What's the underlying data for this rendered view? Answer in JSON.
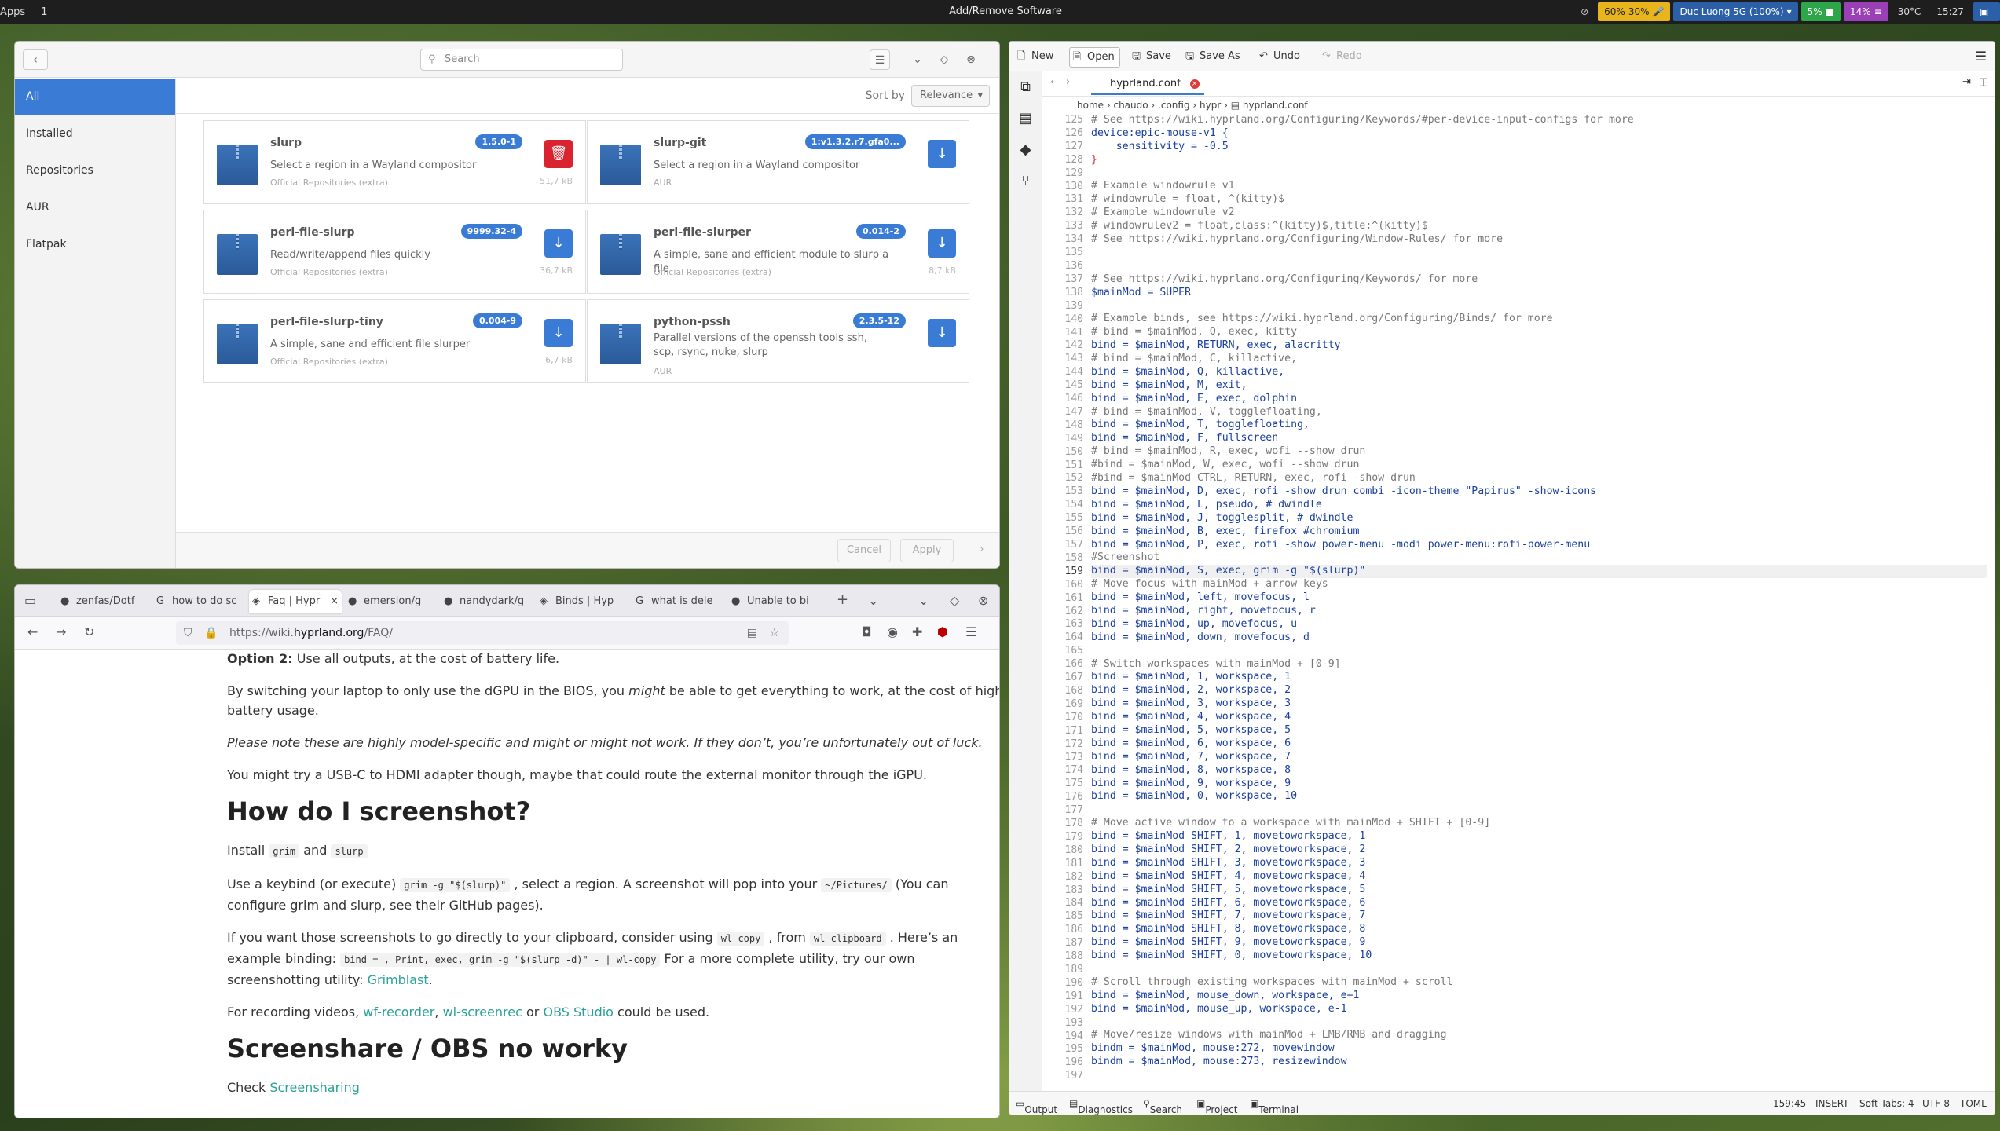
{
  "topbar": {
    "apps": "Apps",
    "workspace": "1",
    "title": "Add/Remove Software",
    "battery": "60%",
    "battery2": "30%",
    "wifi": "Duc Luong 5G (100%)",
    "cpu": "5%",
    "mem": "14%",
    "temp": "30°C",
    "clock": "15:27"
  },
  "software": {
    "search_placeholder": "Search",
    "sidebar": [
      "All",
      "Installed",
      "Repositories",
      "AUR",
      "Flatpak"
    ],
    "sort_label": "Sort by",
    "sort_value": "Relevance",
    "packages": [
      {
        "name": "slurp",
        "version": "1.5.0-1",
        "desc": "Select a region in a Wayland compositor",
        "repo": "Official Repositories (extra)",
        "size": "51,7 kB",
        "action": "delete"
      },
      {
        "name": "slurp-git",
        "version": "1:v1.3.2.r7.gfa0...",
        "desc": "Select a region in a Wayland compositor",
        "repo": "AUR",
        "size": "",
        "action": "install"
      },
      {
        "name": "perl-file-slurp",
        "version": "9999.32-4",
        "desc": "Read/write/append files quickly",
        "repo": "Official Repositories (extra)",
        "size": "36,7 kB",
        "action": "install"
      },
      {
        "name": "perl-file-slurper",
        "version": "0.014-2",
        "desc": "A simple, sane and efficient module to slurp a file",
        "repo": "Official Repositories (extra)",
        "size": "8,7 kB",
        "action": "install"
      },
      {
        "name": "perl-file-slurp-tiny",
        "version": "0.004-9",
        "desc": "A simple, sane and efficient file slurper",
        "repo": "Official Repositories (extra)",
        "size": "6,7 kB",
        "action": "install"
      },
      {
        "name": "python-pssh",
        "version": "2.3.5-12",
        "desc": "Parallel versions of the openssh tools ssh, scp, rsync, nuke, slurp",
        "repo": "AUR",
        "size": "",
        "action": "install"
      }
    ],
    "cancel": "Cancel",
    "apply": "Apply"
  },
  "browser": {
    "tabs": [
      "zenfas/Dotf",
      "how to do sc",
      "Faq | Hypr",
      "emersion/g",
      "nandydark/g",
      "Binds | Hyp",
      "what is dele",
      "Unable to bi"
    ],
    "url_prefix": "https://wiki.",
    "url_host": "hyprland.org",
    "url_path": "/FAQ/",
    "p1_bold": "Option 2:",
    "p1": " Use all outputs, at the cost of battery life.",
    "p2a": "By switching your laptop to only use the dGPU in the BIOS, you ",
    "p2em": "might",
    "p2b": " be able to get everything to work, at the cost of high battery usage.",
    "p3": "Please note these are highly model-specific and might or might not work. If they don’t, you’re unfortunately out of luck.",
    "p4": "You might try a USB-C to HDMI adapter though, maybe that could route the external monitor through the iGPU.",
    "h1": "How do I screenshot?",
    "p5a": "Install ",
    "c_grim": "grim",
    "p5b": " and ",
    "c_slurp": "slurp",
    "p6a": "Use a keybind (or execute) ",
    "c_cmd": "grim -g \"$(slurp)\"",
    "p6b": " , select a region. A screenshot will pop into your ",
    "c_pic": "~/Pictures/",
    "p6c": " (You can configure grim and slurp, see their GitHub pages).",
    "p7a": "If you want those screenshots to go directly to your clipboard, consider using ",
    "c_wl": "wl-copy",
    "p7b": " , from ",
    "c_wlc": "wl-clipboard",
    "p7c": " . Here’s an example binding: ",
    "c_bind": "bind = , Print, exec, grim -g \"$(slurp -d)\" - | wl-copy",
    "p7d": " For a more complete utility, try our own screenshotting utility: ",
    "l_grimblast": "Grimblast",
    "p7e": ".",
    "p8a": "For recording videos, ",
    "l_wfr": "wf-recorder",
    "p8b": ", ",
    "l_wfs": "wl-screenrec",
    "p8c": " or ",
    "l_obs": "OBS Studio",
    "p8d": " could be used.",
    "h2": "Screenshare / OBS no worky",
    "p9a": "Check ",
    "l_ss": "Screensharing"
  },
  "editor": {
    "toolbar": {
      "new": "New",
      "open": "Open",
      "save": "Save",
      "saveas": "Save As",
      "undo": "Undo",
      "redo": "Redo"
    },
    "tab": "hyprland.conf",
    "crumbs": [
      "home",
      "chaudo",
      ".config",
      "hypr",
      "hyprland.conf"
    ],
    "first_line": 125,
    "lines": [
      "# See https://wiki.hyprland.org/Configuring/Keywords/#per-device-input-configs for more",
      "device:epic-mouse-v1 {",
      "    sensitivity = -0.5",
      "}",
      "",
      "# Example windowrule v1",
      "# windowrule = float, ^(kitty)$",
      "# Example windowrule v2",
      "# windowrulev2 = float,class:^(kitty)$,title:^(kitty)$",
      "# See https://wiki.hyprland.org/Configuring/Window-Rules/ for more",
      "",
      "",
      "# See https://wiki.hyprland.org/Configuring/Keywords/ for more",
      "$mainMod = SUPER",
      "",
      "# Example binds, see https://wiki.hyprland.org/Configuring/Binds/ for more",
      "# bind = $mainMod, Q, exec, kitty",
      "bind = $mainMod, RETURN, exec, alacritty",
      "# bind = $mainMod, C, killactive,",
      "bind = $mainMod, Q, killactive,",
      "bind = $mainMod, M, exit,",
      "bind = $mainMod, E, exec, dolphin",
      "# bind = $mainMod, V, togglefloating,",
      "bind = $mainMod, T, togglefloating,",
      "bind = $mainMod, F, fullscreen",
      "# bind = $mainMod, R, exec, wofi --show drun",
      "#bind = $mainMod, W, exec, wofi --show drun",
      "#bind = $mainMod CTRL, RETURN, exec, rofi -show drun",
      "bind = $mainMod, D, exec, rofi -show drun combi -icon-theme \"Papirus\" -show-icons",
      "bind = $mainMod, L, pseudo, # dwindle",
      "bind = $mainMod, J, togglesplit, # dwindle",
      "bind = $mainMod, B, exec, firefox #chromium",
      "bind = $mainMod, P, exec, rofi -show power-menu -modi power-menu:rofi-power-menu",
      "#Screenshot",
      "bind = $mainMod, S, exec, grim -g \"$(slurp)\"",
      "# Move focus with mainMod + arrow keys",
      "bind = $mainMod, left, movefocus, l",
      "bind = $mainMod, right, movefocus, r",
      "bind = $mainMod, up, movefocus, u",
      "bind = $mainMod, down, movefocus, d",
      "",
      "# Switch workspaces with mainMod + [0-9]",
      "bind = $mainMod, 1, workspace, 1",
      "bind = $mainMod, 2, workspace, 2",
      "bind = $mainMod, 3, workspace, 3",
      "bind = $mainMod, 4, workspace, 4",
      "bind = $mainMod, 5, workspace, 5",
      "bind = $mainMod, 6, workspace, 6",
      "bind = $mainMod, 7, workspace, 7",
      "bind = $mainMod, 8, workspace, 8",
      "bind = $mainMod, 9, workspace, 9",
      "bind = $mainMod, 0, workspace, 10",
      "",
      "# Move active window to a workspace with mainMod + SHIFT + [0-9]",
      "bind = $mainMod SHIFT, 1, movetoworkspace, 1",
      "bind = $mainMod SHIFT, 2, movetoworkspace, 2",
      "bind = $mainMod SHIFT, 3, movetoworkspace, 3",
      "bind = $mainMod SHIFT, 4, movetoworkspace, 4",
      "bind = $mainMod SHIFT, 5, movetoworkspace, 5",
      "bind = $mainMod SHIFT, 6, movetoworkspace, 6",
      "bind = $mainMod SHIFT, 7, movetoworkspace, 7",
      "bind = $mainMod SHIFT, 8, movetoworkspace, 8",
      "bind = $mainMod SHIFT, 9, movetoworkspace, 9",
      "bind = $mainMod SHIFT, 0, movetoworkspace, 10",
      "",
      "# Scroll through existing workspaces with mainMod + scroll",
      "bind = $mainMod, mouse_down, workspace, e+1",
      "bind = $mainMod, mouse_up, workspace, e-1",
      "",
      "# Move/resize windows with mainMod + LMB/RMB and dragging",
      "bindm = $mainMod, mouse:272, movewindow",
      "bindm = $mainMod, mouse:273, resizewindow",
      ""
    ],
    "cursor_line": 159,
    "status": {
      "output": "Output",
      "diagnostics": "Diagnostics",
      "search": "Search",
      "project": "Project",
      "terminal": "Terminal",
      "position": "159:45",
      "mode": "INSERT",
      "tabs": "Soft Tabs: 4",
      "encoding": "UTF-8",
      "lang": "TOML"
    }
  }
}
